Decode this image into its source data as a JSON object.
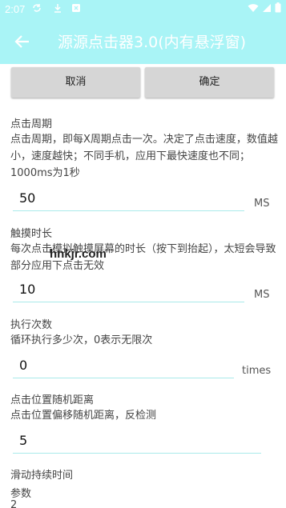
{
  "status_bar": {
    "time": "2:07",
    "icons": [
      "sync-icon",
      "download-icon",
      "app-icon",
      "wifi-icon",
      "signal-icon",
      "battery-icon"
    ]
  },
  "app_bar": {
    "title": "源源点击器3.0(内有悬浮窗)",
    "back_icon": "arrow-left-icon"
  },
  "buttons": {
    "cancel_label": "取消",
    "ok_label": "确定"
  },
  "settings": [
    {
      "label": "点击周期",
      "description": "点击周期，即每X周期点击一次。决定了点击速度，数值越小，速度越快；不同手机，应用下最快速度也不同；1000ms为1秒",
      "value": "50",
      "unit": "MS"
    },
    {
      "label": "触摸时长",
      "description": "每次点击模拟触摸屏幕的时长（按下到抬起），太短会导致部分应用下点击无效",
      "value": "10",
      "unit": "MS"
    },
    {
      "label": "执行次数",
      "description": "循环执行多少次，0表示无限次",
      "value": "0",
      "unit": "times"
    },
    {
      "label": "点击位置随机距离",
      "description": "点击位置偏移随机距离，反检测",
      "value": "5",
      "unit": ""
    },
    {
      "label": "滑动持续时间",
      "description": "参数",
      "value": "2",
      "unit": ""
    }
  ],
  "watermark": "hnkjr.com",
  "colors": {
    "accent": "#a9f4f6",
    "button_bg": "#d6d6d6",
    "underline": "#a9eaea"
  }
}
